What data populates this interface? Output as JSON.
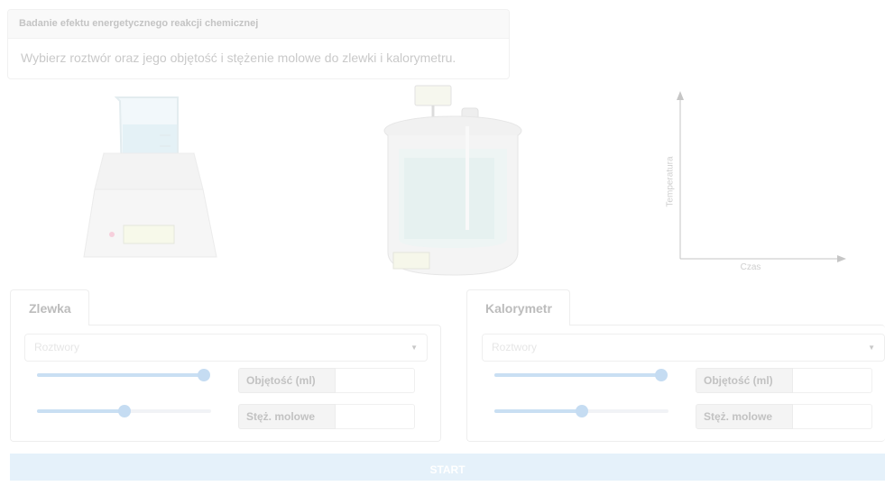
{
  "info": {
    "title": "Badanie efektu energetycznego reakcji chemicznej",
    "instruction": "Wybierz roztwór oraz jego objętość i stężenie molowe do zlewki i kalorymetru."
  },
  "graph": {
    "ylabel": "Temperatura",
    "xlabel": "Czas"
  },
  "beaker_panel": {
    "tab": "Zlewka",
    "select_placeholder": "Roztwory",
    "volume_label": "Objętość (ml)",
    "volume_value": "",
    "volume_slider": 1.0,
    "conc_label": "Stęż. molowe",
    "conc_value": "",
    "conc_slider": 0.5
  },
  "calorimeter_panel": {
    "tab": "Kalorymetr",
    "select_placeholder": "Roztwory",
    "volume_label": "Objętość (ml)",
    "volume_value": "",
    "volume_slider": 1.0,
    "conc_label": "Stęż. molowe",
    "conc_value": "",
    "conc_slider": 0.5
  },
  "start_label": "START",
  "colors": {
    "accent": "#c5dcf2",
    "start_bg": "#e5f1fa"
  }
}
